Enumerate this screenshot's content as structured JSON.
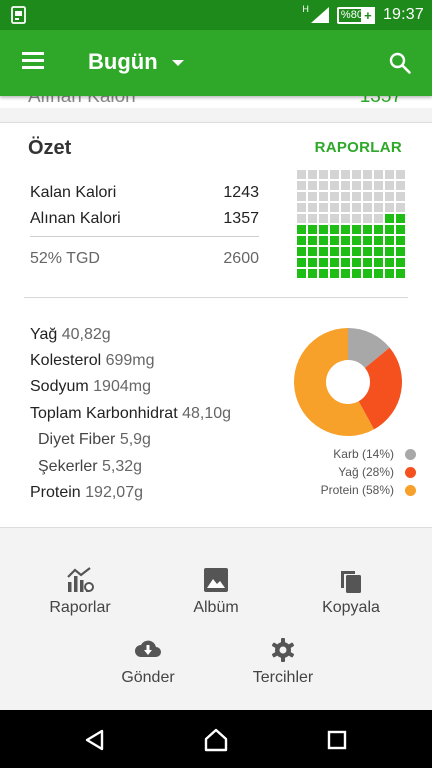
{
  "statusbar": {
    "network_label": "H",
    "battery_label": "%80",
    "battery_plus": "+",
    "time": "19:37"
  },
  "appbar": {
    "title": "Bugün",
    "menu_icon": "menu-icon",
    "dropdown_icon": "chevron-down-icon",
    "search_icon": "search-icon"
  },
  "hidden_row": {
    "label": "Alınan Kalori",
    "value": "1357"
  },
  "summary": {
    "title": "Özet",
    "reports_link": "RAPORLAR",
    "rows": [
      {
        "label": "Kalan Kalori",
        "value": "1243"
      },
      {
        "label": "Alınan Kalori",
        "value": "1357"
      }
    ],
    "tgd_label": "52% TGD",
    "tgd_value": "2600",
    "waffle_filled_fraction": 0.52,
    "colors": {
      "accent": "#2fa82a",
      "filled": "#1fbe14",
      "empty": "#d4d4d4"
    }
  },
  "nutrients": [
    {
      "name": "Yağ",
      "amount": "40,82g"
    },
    {
      "name": "Kolesterol",
      "amount": "699mg"
    },
    {
      "name": "Sodyum",
      "amount": "1904mg"
    },
    {
      "name": "Toplam Karbonhidrat",
      "amount": "48,10g"
    },
    {
      "name": "Diyet Fiber",
      "amount": "5,9g"
    },
    {
      "name": "Şekerler",
      "amount": "5,32g"
    },
    {
      "name": "Protein",
      "amount": "192,07g"
    }
  ],
  "macro_chart": {
    "type": "pie",
    "slices": [
      {
        "label": "Karb (14%)",
        "percent": 14,
        "color": "#a8a8a8"
      },
      {
        "label": "Yağ (28%)",
        "percent": 28,
        "color": "#f4511e"
      },
      {
        "label": "Protein (58%)",
        "percent": 58,
        "color": "#f7a02a"
      }
    ]
  },
  "actions": [
    {
      "label": "Raporlar",
      "icon": "reports-chart-icon"
    },
    {
      "label": "Albüm",
      "icon": "image-icon"
    },
    {
      "label": "Kopyala",
      "icon": "copy-icon"
    },
    {
      "label": "Gönder",
      "icon": "cloud-download-icon"
    },
    {
      "label": "Tercihler",
      "icon": "gear-icon"
    }
  ],
  "navbar": {
    "back_icon": "back-triangle-icon",
    "home_icon": "home-icon",
    "recents_icon": "recents-square-icon"
  }
}
